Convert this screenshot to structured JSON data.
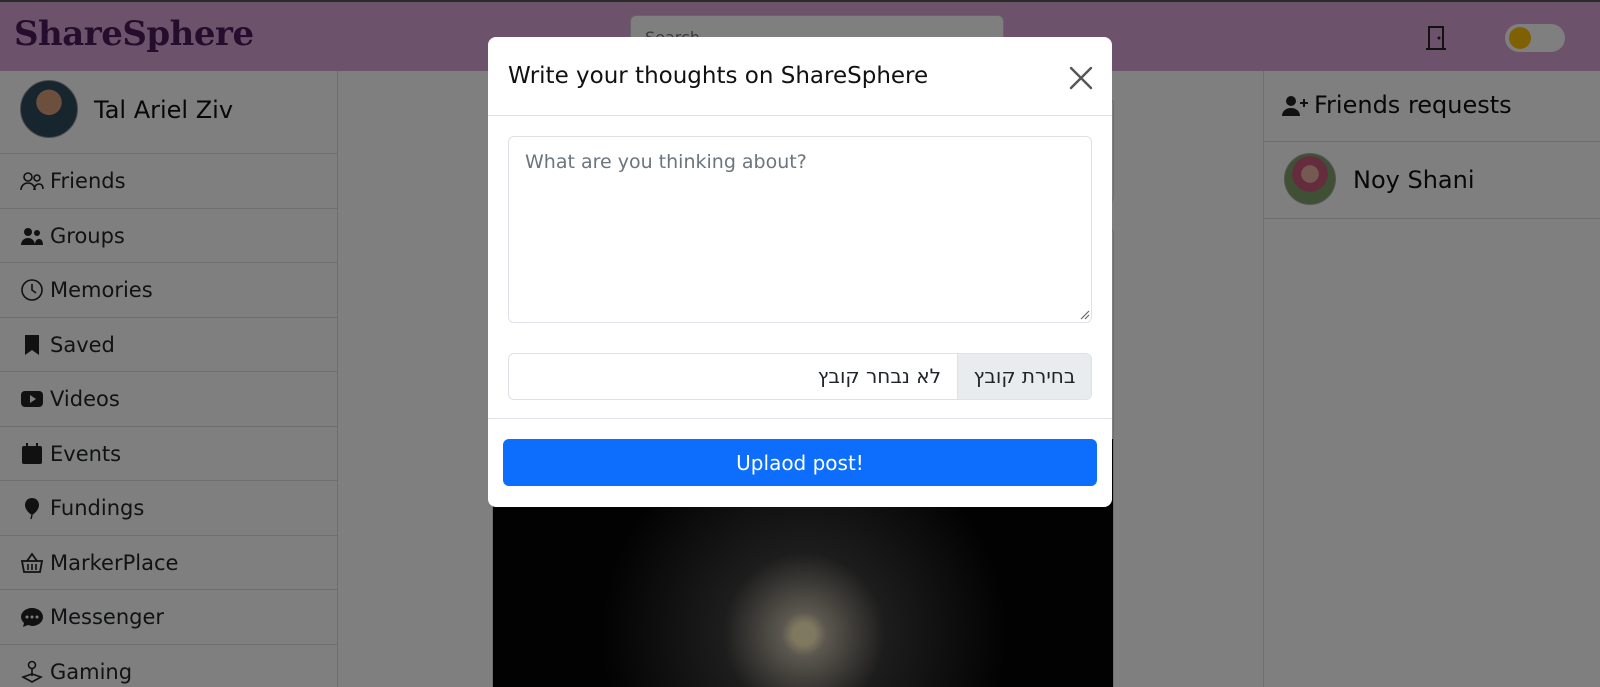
{
  "navbar": {
    "logo": "ShareSphere",
    "search_placeholder": "Search",
    "logout_icon": "door-icon",
    "theme_toggle_icon": "toggle-icon"
  },
  "sidebar": {
    "profile_name": "Tal Ariel Ziv",
    "items": [
      {
        "label": "Friends",
        "icon": "friends-icon"
      },
      {
        "label": "Groups",
        "icon": "groups-icon"
      },
      {
        "label": "Memories",
        "icon": "clock-icon"
      },
      {
        "label": "Saved",
        "icon": "bookmark-icon"
      },
      {
        "label": "Videos",
        "icon": "video-icon"
      },
      {
        "label": "Events",
        "icon": "calendar-icon"
      },
      {
        "label": "Fundings",
        "icon": "balloon-icon"
      },
      {
        "label": "MarkerPlace",
        "icon": "basket-icon"
      },
      {
        "label": "Messenger",
        "icon": "chat-icon"
      },
      {
        "label": "Gaming",
        "icon": "joystick-icon"
      }
    ]
  },
  "rightbar": {
    "heading": "Friends requests",
    "requests": [
      {
        "name": "Noy Shani"
      }
    ]
  },
  "modal": {
    "title": "Write your thoughts on ShareSphere",
    "textarea_placeholder": "What are you thinking about?",
    "file_button_label": "בחירת קובץ",
    "file_status": "לא נבחר קובץ",
    "submit_label": "Uplaod post!"
  },
  "colors": {
    "navbar_bg": "#d9a7d6",
    "logo": "#4a1a5a",
    "primary": "#0d6efd",
    "toggle_knob": "#ffc107"
  }
}
